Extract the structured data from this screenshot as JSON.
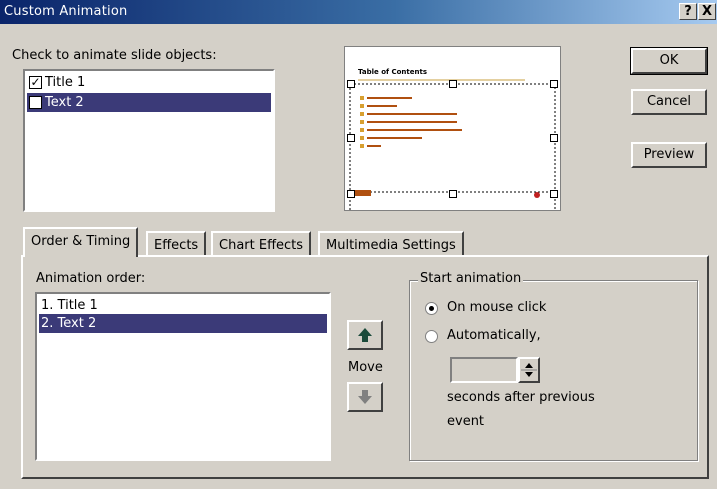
{
  "window": {
    "title": "Custom Animation",
    "help_label": "?",
    "close_label": "X"
  },
  "objects": {
    "label": "Check to animate slide objects:",
    "items": [
      {
        "label": "Title 1",
        "checked": true,
        "selected": false
      },
      {
        "label": "Text 2",
        "checked": true,
        "selected": true
      }
    ]
  },
  "preview_slide": {
    "title": "Table of Contents"
  },
  "buttons": {
    "ok": "OK",
    "cancel": "Cancel",
    "preview": "Preview"
  },
  "tabs": [
    "Order & Timing",
    "Effects",
    "Chart Effects",
    "Multimedia Settings"
  ],
  "order": {
    "label": "Animation order:",
    "items": [
      "1. Title 1",
      "2. Text 2"
    ],
    "selected_index": 1,
    "move_label": "Move"
  },
  "start": {
    "group_label": "Start animation",
    "on_click_label": "On mouse click",
    "auto_label": "Automatically,",
    "seconds_value": "",
    "seconds_after": "seconds after previous",
    "seconds_after_2": "event",
    "selected": "on_click"
  },
  "colors": {
    "selection": "#3b3a78",
    "face": "#d4d0c8"
  }
}
